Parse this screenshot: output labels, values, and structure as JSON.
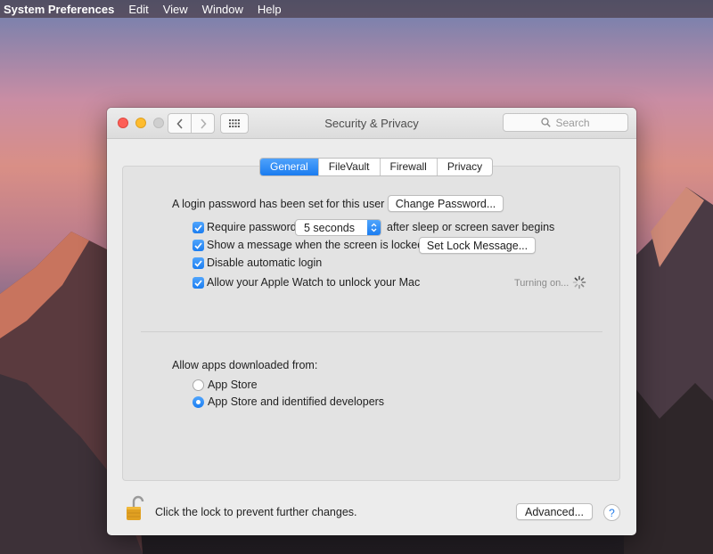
{
  "menubar": {
    "app_name": "System Preferences",
    "items": [
      "Edit",
      "View",
      "Window",
      "Help"
    ]
  },
  "window": {
    "title": "Security & Privacy",
    "search_placeholder": "Search"
  },
  "tabs": [
    {
      "label": "General",
      "active": true
    },
    {
      "label": "FileVault",
      "active": false
    },
    {
      "label": "Firewall",
      "active": false
    },
    {
      "label": "Privacy",
      "active": false
    }
  ],
  "general": {
    "login_password_text": "A login password has been set for this user",
    "change_password_button": "Change Password...",
    "require_password": {
      "label": "Require password",
      "checked": true
    },
    "password_delay_select": "5 seconds",
    "after_sleep_text": "after sleep or screen saver begins",
    "show_message": {
      "label": "Show a message when the screen is locked",
      "checked": true
    },
    "set_lock_message_button": "Set Lock Message...",
    "disable_auto_login": {
      "label": "Disable automatic login",
      "checked": true
    },
    "apple_watch": {
      "label": "Allow your Apple Watch to unlock your Mac",
      "checked": true
    },
    "turning_on_status": "Turning on...",
    "allow_apps_label": "Allow apps downloaded from:",
    "app_sources": [
      {
        "label": "App Store",
        "selected": false
      },
      {
        "label": "App Store and identified developers",
        "selected": true
      }
    ]
  },
  "footer": {
    "lock_text": "Click the lock to prevent further changes.",
    "advanced_button": "Advanced...",
    "help_glyph": "?"
  },
  "colors": {
    "accent": "#1b7df1",
    "window_bg": "#ececec"
  },
  "icons": [
    "back-icon",
    "forward-icon",
    "grid-icon",
    "search-icon",
    "checkmark-icon",
    "chevron-updown-icon",
    "spinner-icon",
    "padlock-open-icon",
    "help-icon"
  ]
}
